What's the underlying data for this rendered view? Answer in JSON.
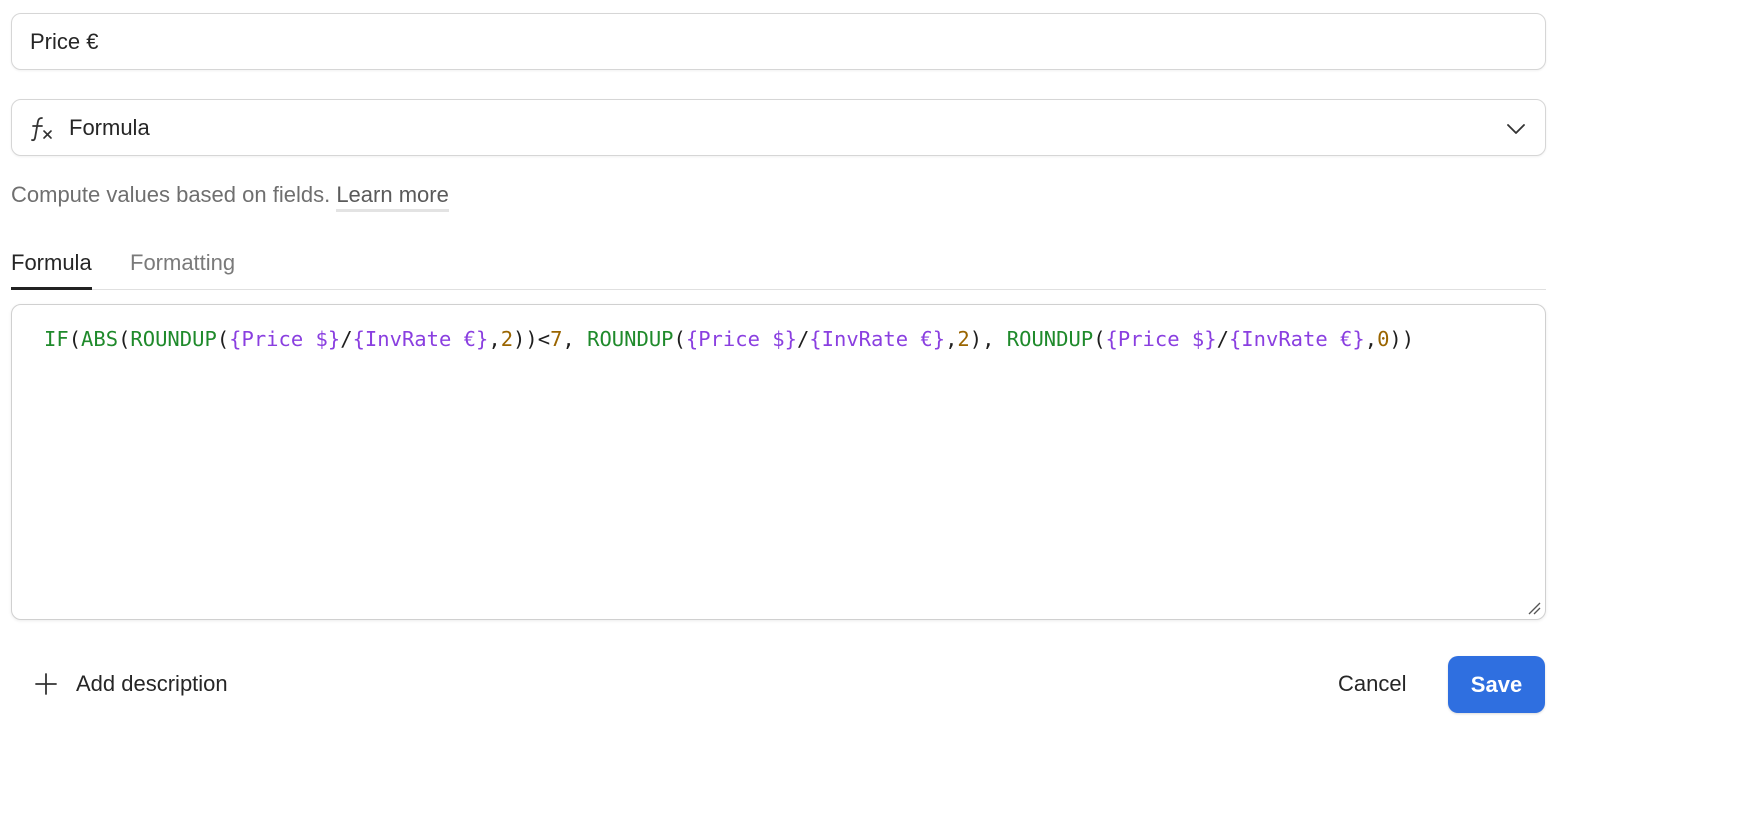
{
  "field_name": {
    "value": "Price €"
  },
  "field_type": {
    "icon": "formula-icon",
    "selected": "Formula",
    "dropdown_icon": "chevron-down-icon"
  },
  "helper": {
    "text": "Compute values based on fields. ",
    "link": "Learn more"
  },
  "tabs": [
    {
      "label": "Formula",
      "active": true
    },
    {
      "label": "Formatting",
      "active": false
    }
  ],
  "formula": {
    "tokens": [
      {
        "t": "fn",
        "v": "IF"
      },
      {
        "t": "p",
        "v": "("
      },
      {
        "t": "fn",
        "v": "ABS"
      },
      {
        "t": "p",
        "v": "("
      },
      {
        "t": "fn",
        "v": "ROUNDUP"
      },
      {
        "t": "p",
        "v": "("
      },
      {
        "t": "ref",
        "v": "{Price $}"
      },
      {
        "t": "p",
        "v": "/"
      },
      {
        "t": "ref",
        "v": "{InvRate €}"
      },
      {
        "t": "p",
        "v": ","
      },
      {
        "t": "num",
        "v": "2"
      },
      {
        "t": "p",
        "v": "))<"
      },
      {
        "t": "num",
        "v": "7"
      },
      {
        "t": "p",
        "v": ", "
      },
      {
        "t": "fn",
        "v": "ROUNDUP"
      },
      {
        "t": "p",
        "v": "("
      },
      {
        "t": "ref",
        "v": "{Price $}"
      },
      {
        "t": "p",
        "v": "/"
      },
      {
        "t": "ref",
        "v": "{InvRate €}"
      },
      {
        "t": "p",
        "v": ","
      },
      {
        "t": "num",
        "v": "2"
      },
      {
        "t": "p",
        "v": "), "
      },
      {
        "t": "fn",
        "v": "ROUNDUP"
      },
      {
        "t": "p",
        "v": "("
      },
      {
        "t": "ref",
        "v": "{Price $}"
      },
      {
        "t": "p",
        "v": "/"
      },
      {
        "t": "ref",
        "v": "{InvRate €}"
      },
      {
        "t": "p",
        "v": ","
      },
      {
        "t": "num",
        "v": "0"
      },
      {
        "t": "p",
        "v": "))"
      }
    ]
  },
  "footer": {
    "add_description_icon": "plus-icon",
    "add_description_label": "Add description",
    "cancel_label": "Cancel",
    "save_label": "Save"
  },
  "colors": {
    "accent": "#2f6fe0",
    "function": "#1f8a2b",
    "field_reference": "#8a3fe0",
    "number": "#9a6500"
  }
}
